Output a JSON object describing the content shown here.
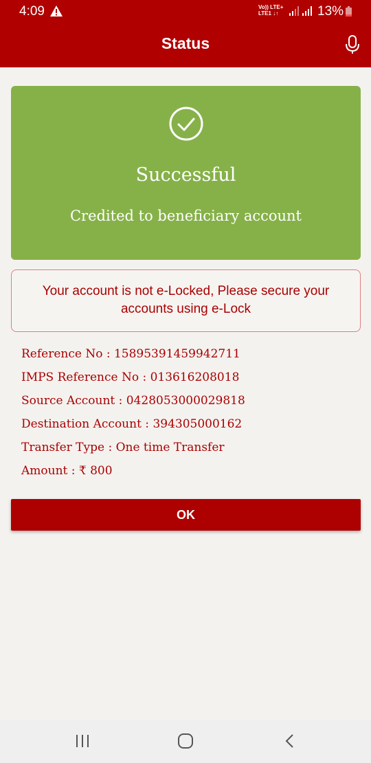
{
  "status_bar": {
    "time": "4:09",
    "network_line1": "Vo)) LTE+",
    "network_line2": "LTE1 ↓↑",
    "battery": "13%"
  },
  "app_bar": {
    "title": "Status"
  },
  "success": {
    "title": "Successful",
    "subtitle": "Credited to beneficiary account"
  },
  "warning": {
    "message": "Your account is not e-Locked, Please secure your accounts using e-Lock"
  },
  "details": [
    {
      "text": "Reference No : 15895391459942711"
    },
    {
      "text": "IMPS Reference No : 013616208018"
    },
    {
      "text": "Source Account : 0428053000029818"
    },
    {
      "text": "Destination Account : 394305000162"
    },
    {
      "text": "Transfer Type : One time Transfer"
    },
    {
      "text": "Amount : ₹ 800"
    }
  ],
  "ok_button": {
    "label": "OK"
  },
  "colors": {
    "brand": "#b00000",
    "success": "#86b149",
    "text_accent": "#a80000"
  }
}
